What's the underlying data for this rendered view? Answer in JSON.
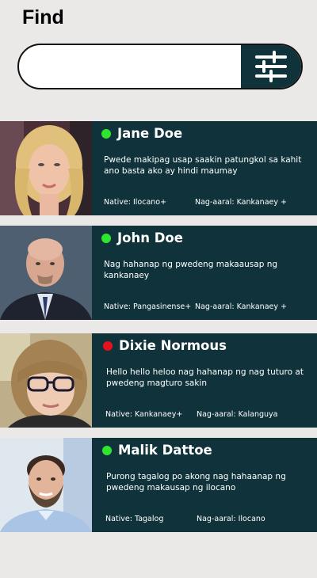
{
  "header": {
    "title": "Find"
  },
  "search": {
    "placeholder": "",
    "value": ""
  },
  "colors": {
    "card_bg": "#10333b",
    "online": "#2ee62e",
    "offline": "#e8101e",
    "page_bg": "#ebe9e7"
  },
  "profiles": [
    {
      "name": "Jane Doe",
      "status": "online",
      "bio": "Pwede makipag usap saakin patungkol sa kahit ano basta ako ay hindi maumay",
      "native": "Native: Ilocano+",
      "learning": "Nag-aaral: Kankanaey +"
    },
    {
      "name": "John Doe",
      "status": "online",
      "bio": "Nag hahanap ng pwedeng makaausap ng kankanaey",
      "native": "Native: Pangasinense+",
      "learning": "Nag-aaral: Kankanaey +"
    },
    {
      "name": "Dixie Normous",
      "status": "offline",
      "bio": "Hello hello heloo nag hahanap ng  nag tuturo at pwedeng magturo sakin",
      "native": "Native: Kankanaey+",
      "learning": "Nag-aaral: Kalanguya"
    },
    {
      "name": "Malik Dattoe",
      "status": "online",
      "bio": "Purong tagalog po akong nag hahaanap ng pwedeng makausap ng ilocano",
      "native": "Native: Tagalog",
      "learning": "Nag-aaral: Ilocano"
    }
  ]
}
